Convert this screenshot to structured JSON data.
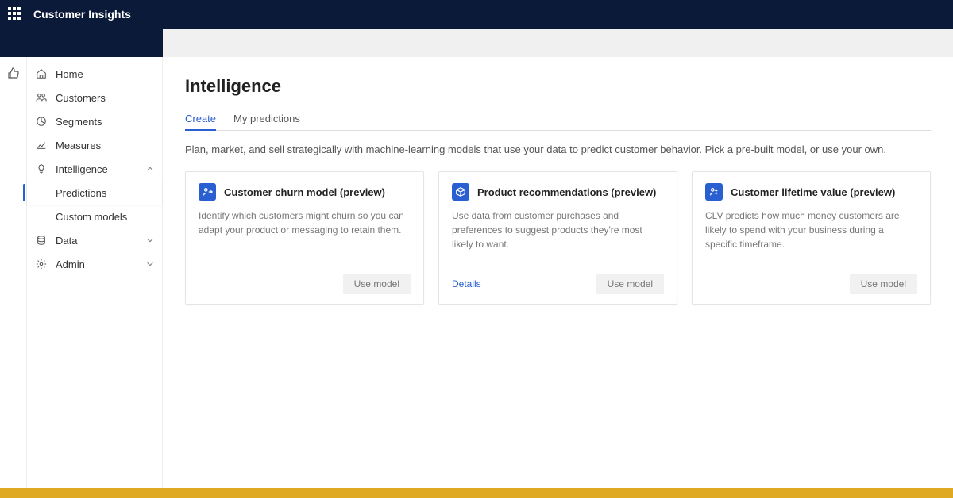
{
  "header": {
    "app_name": "Customer Insights"
  },
  "sidebar": {
    "items": [
      {
        "label": "Home"
      },
      {
        "label": "Customers"
      },
      {
        "label": "Segments"
      },
      {
        "label": "Measures"
      },
      {
        "label": "Intelligence"
      },
      {
        "label": "Data"
      },
      {
        "label": "Admin"
      }
    ],
    "intelligence_children": [
      {
        "label": "Predictions"
      },
      {
        "label": "Custom models"
      }
    ]
  },
  "page": {
    "title": "Intelligence",
    "tabs": [
      {
        "label": "Create"
      },
      {
        "label": "My predictions"
      }
    ],
    "intro": "Plan, market, and sell strategically with machine-learning models that use your data to predict customer behavior. Pick a pre-built model, or use your own.",
    "cards": [
      {
        "title": "Customer churn model (preview)",
        "desc": "Identify which customers might churn so you can adapt your product or messaging to retain them.",
        "button": "Use model"
      },
      {
        "title": "Product recommendations (preview)",
        "desc": "Use data from customer purchases and preferences to suggest products they're most likely to want.",
        "details": "Details",
        "button": "Use model"
      },
      {
        "title": "Customer lifetime value (preview)",
        "desc": "CLV predicts how much money customers are likely to spend with your business during a specific timeframe.",
        "button": "Use model"
      }
    ]
  }
}
